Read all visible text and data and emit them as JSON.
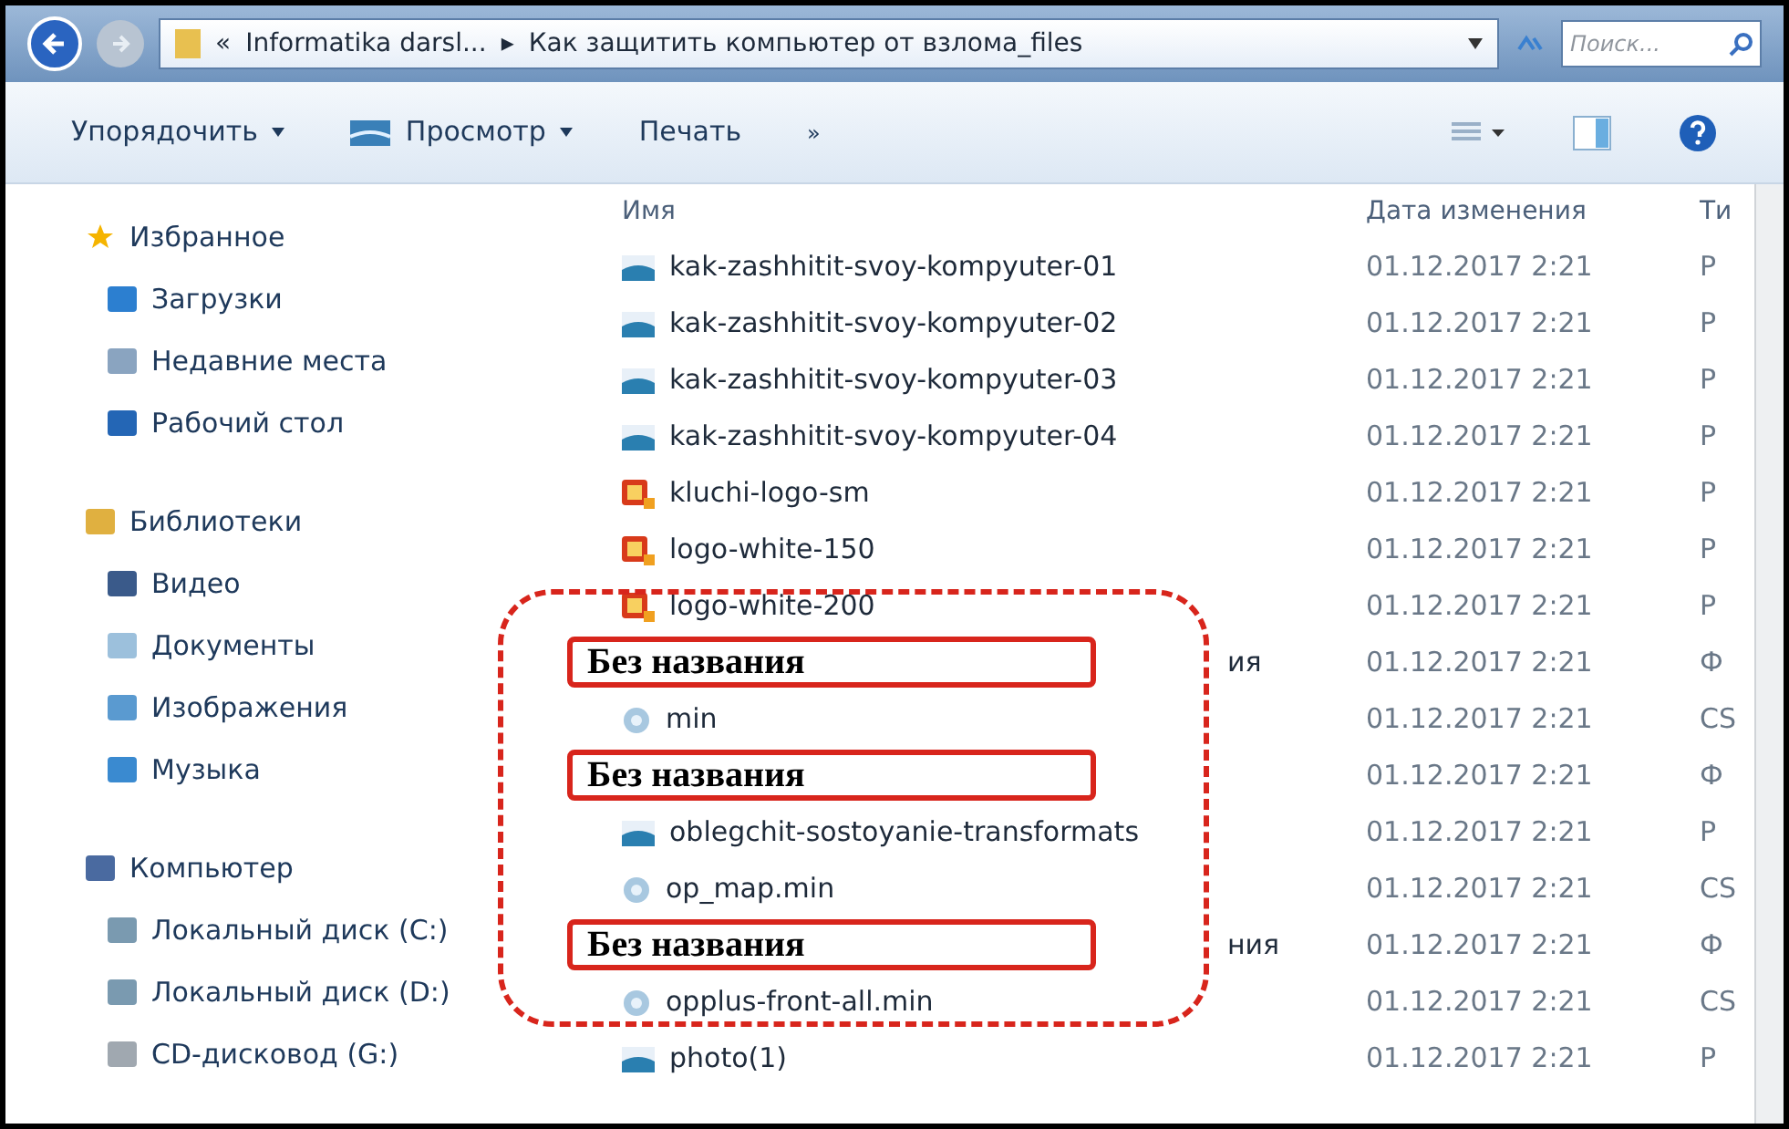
{
  "address_bar": {
    "breadcrumb_prefix": "«",
    "segments": [
      "Informatika darsl...",
      "Как защитить компьютер от взлома_files"
    ],
    "separator": "▸",
    "search": {
      "placeholder": "Поиск..."
    }
  },
  "toolbar": {
    "buttons": [
      {
        "label": "Упорядочить",
        "dropdown": true
      },
      {
        "label": "Просмотр",
        "dropdown": true
      },
      {
        "label": "Печать",
        "dropdown": false
      }
    ],
    "overflow": "»"
  },
  "sidebar": {
    "groups": [
      {
        "label": "Избранное",
        "items": [
          {
            "label": "Загрузки"
          },
          {
            "label": "Недавние места"
          },
          {
            "label": "Рабочий стол"
          }
        ]
      },
      {
        "label": "Библиотеки",
        "items": [
          {
            "label": "Видео"
          },
          {
            "label": "Документы"
          },
          {
            "label": "Изображения"
          },
          {
            "label": "Музыка"
          }
        ]
      },
      {
        "label": "Компьютер",
        "items": [
          {
            "label": "Локальный диск (C:)"
          },
          {
            "label": "Локальный диск (D:)"
          },
          {
            "label": "CD-дисковод (G:)"
          }
        ]
      }
    ]
  },
  "file_list": {
    "columns": [
      "Имя",
      "Дата изменения",
      "Ти"
    ],
    "rows": [
      {
        "name": "kak-zashhitit-svoy-kompyuter-01",
        "date": "01.12.2017 2:21",
        "type": "Р",
        "kind": "image"
      },
      {
        "name": "kak-zashhitit-svoy-kompyuter-02",
        "date": "01.12.2017 2:21",
        "type": "Р",
        "kind": "image"
      },
      {
        "name": "kak-zashhitit-svoy-kompyuter-03",
        "date": "01.12.2017 2:21",
        "type": "Р",
        "kind": "image"
      },
      {
        "name": "kak-zashhitit-svoy-kompyuter-04",
        "date": "01.12.2017 2:21",
        "type": "Р",
        "kind": "image"
      },
      {
        "name": "kluchi-logo-sm",
        "date": "01.12.2017 2:21",
        "type": "Р",
        "kind": "png"
      },
      {
        "name": "logo-white-150",
        "date": "01.12.2017 2:21",
        "type": "Р",
        "kind": "png"
      },
      {
        "name": "logo-white-200",
        "date": "01.12.2017 2:21",
        "type": "Р",
        "kind": "png"
      },
      {
        "name": "ия",
        "date": "01.12.2017 2:21",
        "type": "Ф",
        "kind": "folder",
        "callout": "Без названия"
      },
      {
        "name": "min",
        "date": "01.12.2017 2:21",
        "type": "CS",
        "kind": "css"
      },
      {
        "date": "01.12.2017 2:21",
        "type": "Ф",
        "kind": "folder",
        "callout": "Без названия"
      },
      {
        "name": "oblegchit-sostoyanie-transformats",
        "date": "01.12.2017 2:21",
        "type": "Р",
        "kind": "image"
      },
      {
        "name": "op_map.min",
        "date": "01.12.2017 2:21",
        "type": "CS",
        "kind": "css"
      },
      {
        "name": "ния",
        "date": "01.12.2017 2:21",
        "type": "Ф",
        "kind": "folder",
        "callout": "Без названия"
      },
      {
        "name": "opplus-front-all.min",
        "date": "01.12.2017 2:21",
        "type": "CS",
        "kind": "css"
      },
      {
        "name": "photo(1)",
        "date": "01.12.2017 2:21",
        "type": "Р",
        "kind": "image"
      }
    ]
  }
}
